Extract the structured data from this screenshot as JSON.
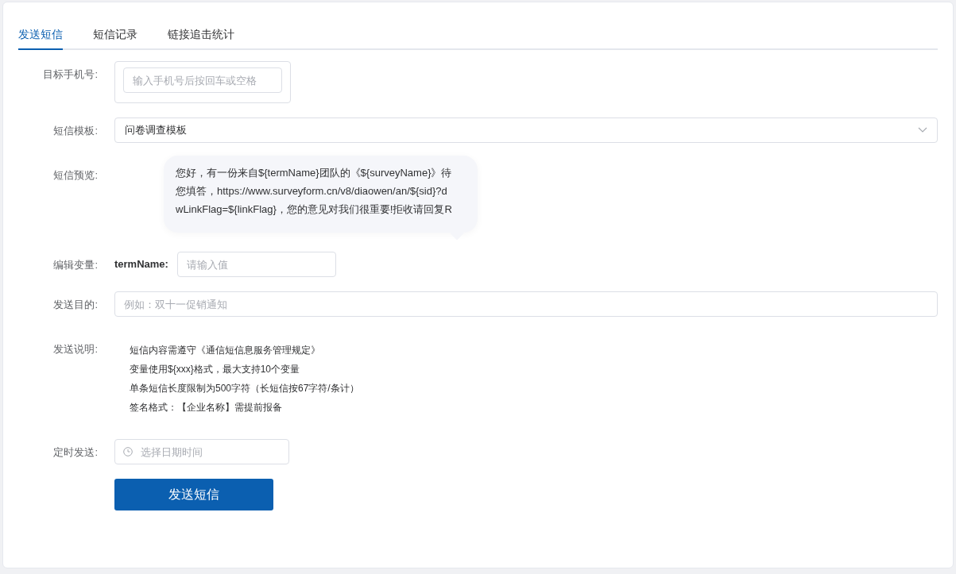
{
  "tabs": [
    {
      "label": "发送短信",
      "selected": true
    },
    {
      "label": "短信记录",
      "selected": false
    },
    {
      "label": "链接追击统计",
      "selected": false
    }
  ],
  "target_phone": {
    "label": "目标手机号:",
    "placeholder": "输入手机号后按回车或空格"
  },
  "template": {
    "label": "短信模板:",
    "value": "问卷调查模板"
  },
  "preview": {
    "label": "短信预览:",
    "text": "您好，有一份来自${termName}团队的《${surveyName}》待您填答，https://www.surveyform.cn/v8/diaowen/an/${sid}?dwLinkFlag=${linkFlag}，您的意见对我们很重要!拒收请回复R"
  },
  "variables": {
    "label": "编辑变量:",
    "items": [
      {
        "name": "termName:",
        "placeholder": "请输入值"
      }
    ]
  },
  "purpose": {
    "label": "发送目的:",
    "placeholder": "例如：双十一促销通知"
  },
  "notes": {
    "label": "发送说明:",
    "lines": [
      "短信内容需遵守《通信短信息服务管理规定》",
      "变量使用${xxx}格式，最大支持10个变量",
      "单条短信长度限制为500字符（长短信按67字符/条计）",
      "签名格式：【企业名称】需提前报备"
    ]
  },
  "schedule": {
    "label": "定时发送:",
    "placeholder": "选择日期时间"
  },
  "submit": "发送短信"
}
